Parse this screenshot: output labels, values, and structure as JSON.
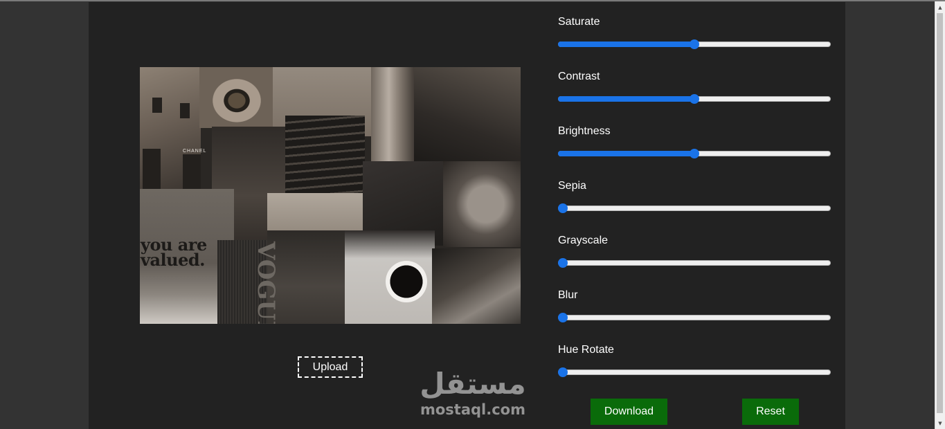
{
  "editor": {
    "upload_label": "Upload",
    "download_label": "Download",
    "reset_label": "Reset",
    "accent_color": "#1a73e8",
    "button_color": "#0a6b0a"
  },
  "image": {
    "text_line1": "you are",
    "text_line2": "valued.",
    "magazine": "VOGUE",
    "shop_sign": "CHANEL"
  },
  "filters": [
    {
      "label": "Saturate",
      "value": 0.5
    },
    {
      "label": "Contrast",
      "value": 0.5
    },
    {
      "label": "Brightness",
      "value": 0.5
    },
    {
      "label": "Sepia",
      "value": 0
    },
    {
      "label": "Grayscale",
      "value": 0
    },
    {
      "label": "Blur",
      "value": 0
    },
    {
      "label": "Hue Rotate",
      "value": 0
    }
  ],
  "watermark": {
    "arabic": "مستقل",
    "latin": "mostaql.com"
  }
}
